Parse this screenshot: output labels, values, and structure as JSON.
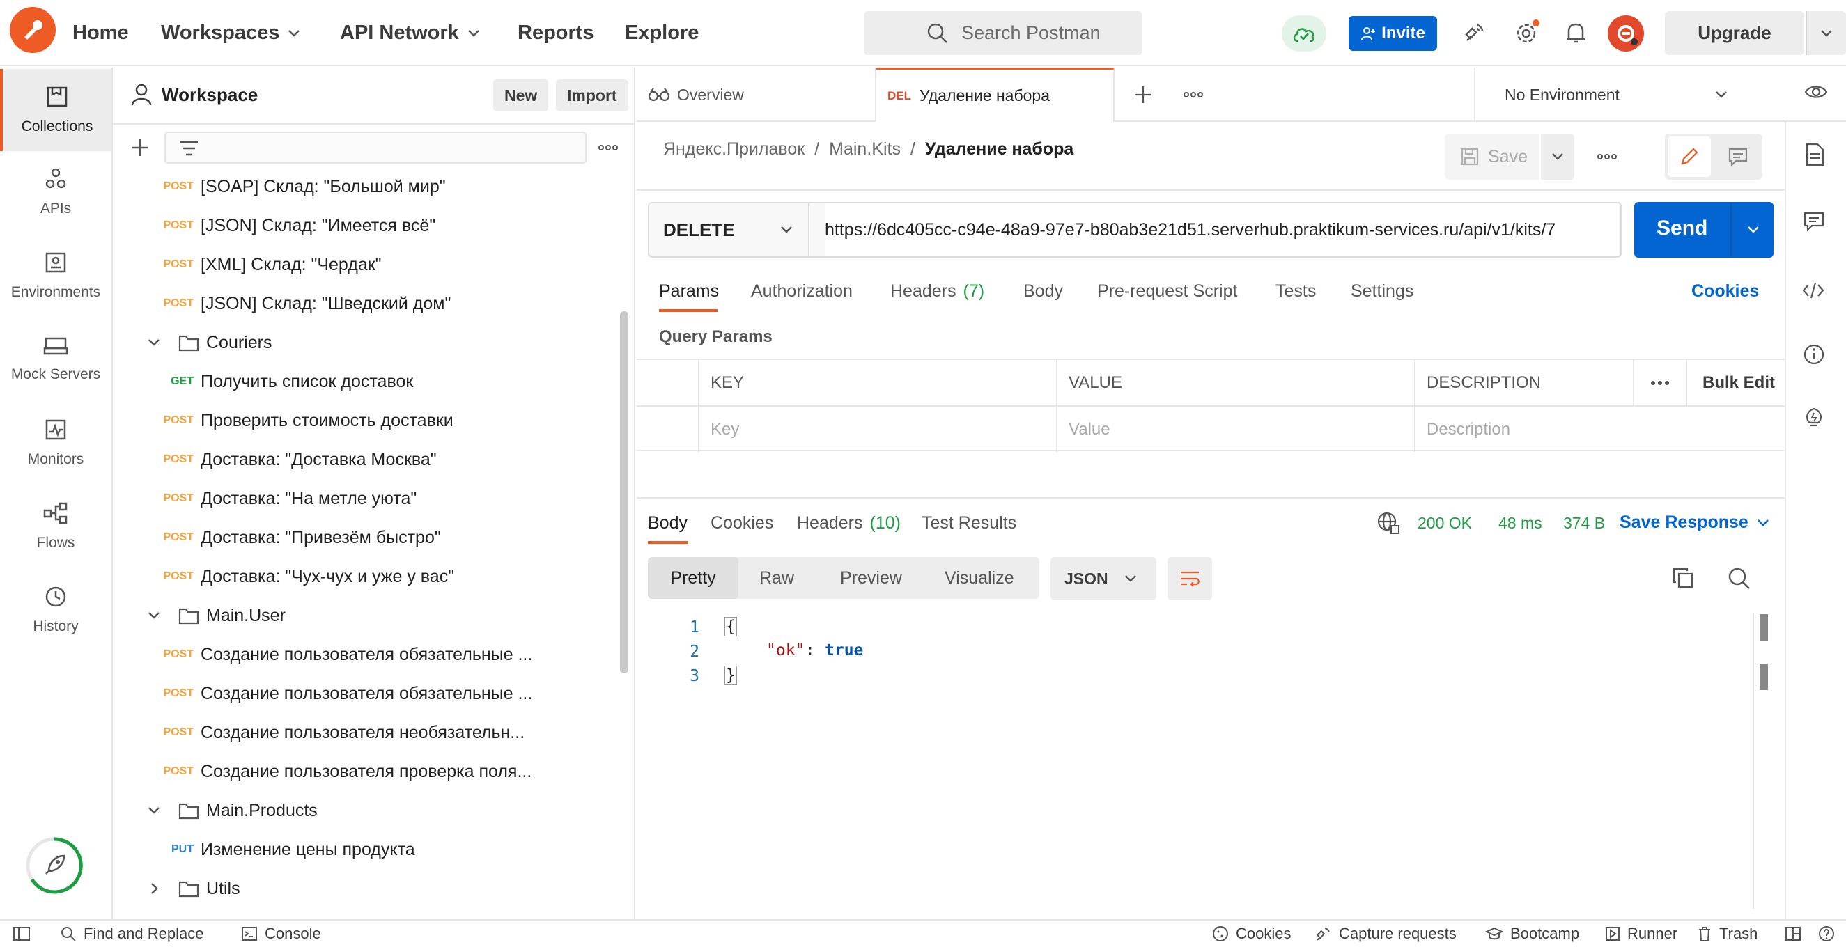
{
  "topbar": {
    "nav": [
      "Home",
      "Workspaces",
      "API Network",
      "Reports",
      "Explore"
    ],
    "search_placeholder": "Search Postman",
    "invite_label": "Invite",
    "upgrade_label": "Upgrade"
  },
  "rail": [
    {
      "label": "Collections",
      "icon": "collections-icon"
    },
    {
      "label": "APIs",
      "icon": "apis-icon"
    },
    {
      "label": "Environments",
      "icon": "environments-icon"
    },
    {
      "label": "Mock Servers",
      "icon": "mock-servers-icon"
    },
    {
      "label": "Monitors",
      "icon": "monitors-icon"
    },
    {
      "label": "Flows",
      "icon": "flows-icon"
    },
    {
      "label": "History",
      "icon": "history-icon"
    }
  ],
  "sidebar": {
    "workspace_title": "Workspace",
    "new_label": "New",
    "import_label": "Import",
    "items": [
      {
        "type": "request",
        "method": "POST",
        "label": "[SOAP] Склад: \"Большой мир\""
      },
      {
        "type": "request",
        "method": "POST",
        "label": "[JSON] Склад: \"Имеется всё\""
      },
      {
        "type": "request",
        "method": "POST",
        "label": "[XML] Склад: \"Чердак\""
      },
      {
        "type": "request",
        "method": "POST",
        "label": "[JSON] Склад: \"Шведский дом\""
      },
      {
        "type": "folder",
        "label": "Couriers"
      },
      {
        "type": "request",
        "method": "GET",
        "label": "Получить список доставок"
      },
      {
        "type": "request",
        "method": "POST",
        "label": "Проверить стоимость доставки"
      },
      {
        "type": "request",
        "method": "POST",
        "label": "Доставка: \"Доставка Москва\""
      },
      {
        "type": "request",
        "method": "POST",
        "label": "Доставка: \"На метле уюта\""
      },
      {
        "type": "request",
        "method": "POST",
        "label": "Доставка: \"Привезём быстро\""
      },
      {
        "type": "request",
        "method": "POST",
        "label": "Доставка: \"Чух-чух и уже у вас\""
      },
      {
        "type": "folder",
        "label": "Main.User"
      },
      {
        "type": "request",
        "method": "POST",
        "label": "Создание пользователя обязательные ..."
      },
      {
        "type": "request",
        "method": "POST",
        "label": "Создание пользователя обязательные ..."
      },
      {
        "type": "request",
        "method": "POST",
        "label": "Создание пользователя необязательн..."
      },
      {
        "type": "request",
        "method": "POST",
        "label": "Создание пользователя проверка поля..."
      },
      {
        "type": "folder",
        "label": "Main.Products"
      },
      {
        "type": "request",
        "method": "PUT",
        "label": "Изменение цены продукта"
      },
      {
        "type": "folder-collapsed",
        "label": "Utils"
      }
    ]
  },
  "tabs": {
    "overview_label": "Overview",
    "active_method": "DEL",
    "active_label": "Удаление набора",
    "environment": "No Environment"
  },
  "request": {
    "breadcrumb": [
      "Яндекс.Прилавок",
      "/",
      "Main.Kits",
      "/",
      "Удаление набора"
    ],
    "save_label": "Save",
    "method": "DELETE",
    "url": "https://6dc405cc-c94e-48a9-97e7-b80ab3e21d51.serverhub.praktikum-services.ru/api/v1/kits/7",
    "send_label": "Send",
    "tabs": [
      "Params",
      "Authorization",
      "Headers",
      "Body",
      "Pre-request Script",
      "Tests",
      "Settings"
    ],
    "headers_count": "(7)",
    "cookies_label": "Cookies",
    "query_params_label": "Query Params",
    "columns": [
      "KEY",
      "VALUE",
      "DESCRIPTION"
    ],
    "bulk_edit_label": "Bulk Edit",
    "placeholders": [
      "Key",
      "Value",
      "Description"
    ]
  },
  "response": {
    "tabs": [
      "Body",
      "Cookies",
      "Headers",
      "Test Results"
    ],
    "headers_count": "(10)",
    "status": "200 OK",
    "time": "48 ms",
    "size": "374 B",
    "save_response_label": "Save Response",
    "views": [
      "Pretty",
      "Raw",
      "Preview",
      "Visualize"
    ],
    "format": "JSON",
    "lines": [
      "1",
      "2",
      "3"
    ],
    "body_open": "{",
    "body_key": "\"ok\"",
    "body_colon": ": ",
    "body_value": "true",
    "body_close": "}"
  },
  "bottombar": {
    "left": [
      "Find and Replace",
      "Console"
    ],
    "right": [
      "Cookies",
      "Capture requests",
      "Bootcamp",
      "Runner",
      "Trash"
    ]
  },
  "colors": {
    "accent": "#ef5b25",
    "primary": "#0265d2",
    "success": "#1d9e42",
    "post": "#f3a33c"
  }
}
